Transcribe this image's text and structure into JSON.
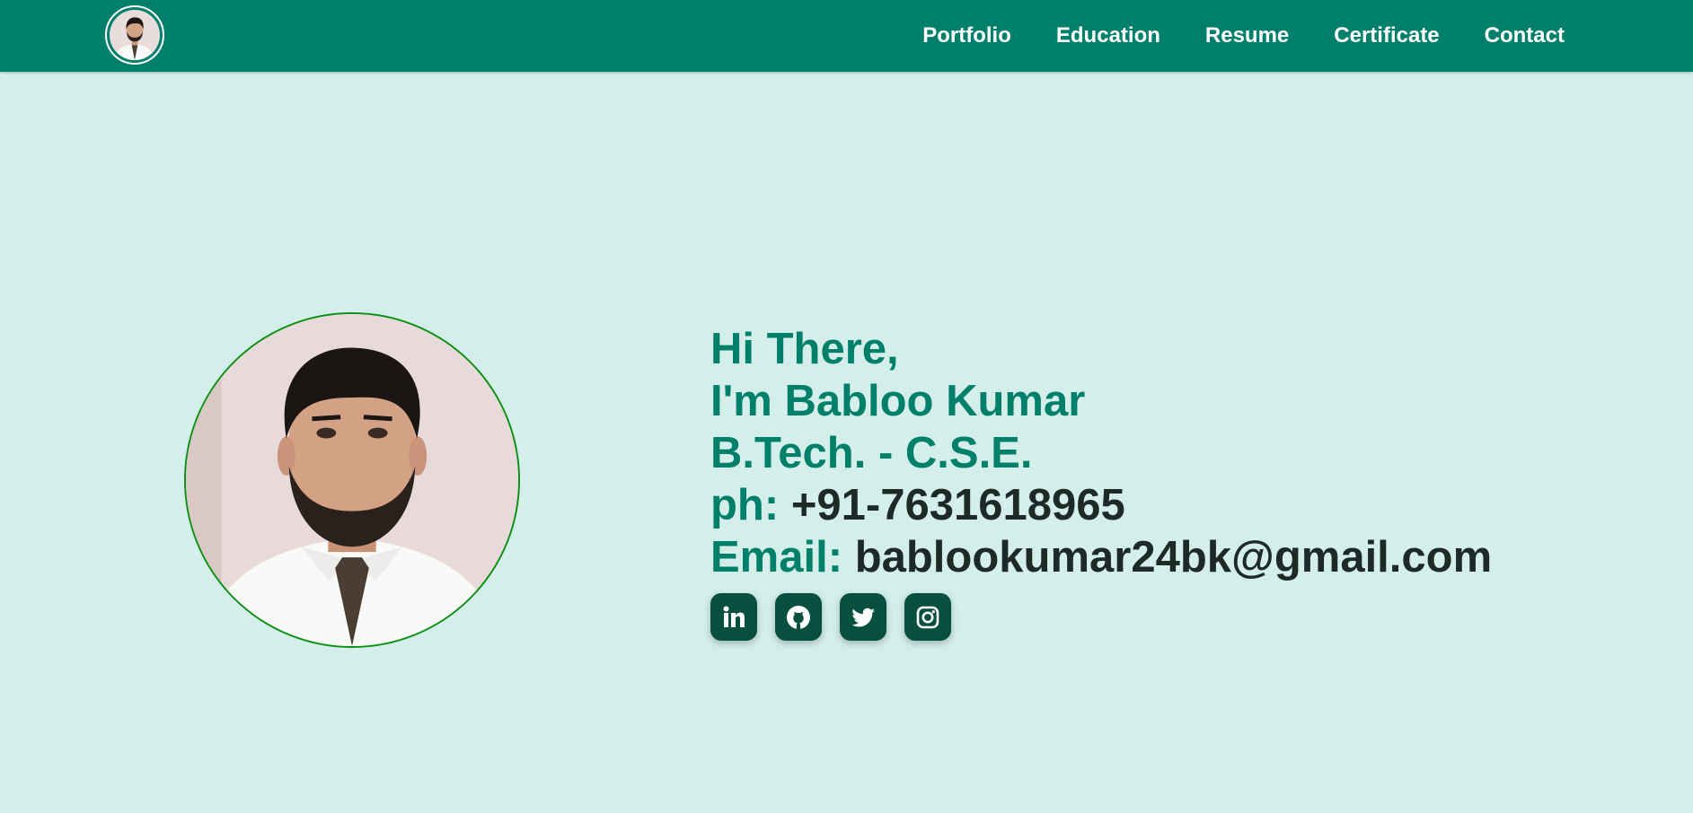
{
  "header": {
    "avatar_icon": "profile-avatar-icon",
    "nav": [
      {
        "label": "Portfolio"
      },
      {
        "label": "Education"
      },
      {
        "label": "Resume"
      },
      {
        "label": "Certificate"
      },
      {
        "label": "Contact"
      }
    ]
  },
  "hero": {
    "greeting": "Hi There,",
    "name_line": "I'm Babloo Kumar",
    "degree": "B.Tech. - C.S.E.",
    "phone_label": "ph:",
    "phone_value": "+91-7631618965",
    "email_label": "Email:",
    "email_value": "bablookumar24bk@gmail.com"
  },
  "socials": [
    {
      "icon": "linkedin-icon"
    },
    {
      "icon": "github-icon"
    },
    {
      "icon": "twitter-icon"
    },
    {
      "icon": "instagram-icon"
    }
  ],
  "colors": {
    "navbar": "#00806b",
    "background": "#d4efe9",
    "accent_text": "#00806b",
    "value_text": "#1e2a28",
    "social_button": "#07503f",
    "photo_border": "#0b8f14"
  }
}
